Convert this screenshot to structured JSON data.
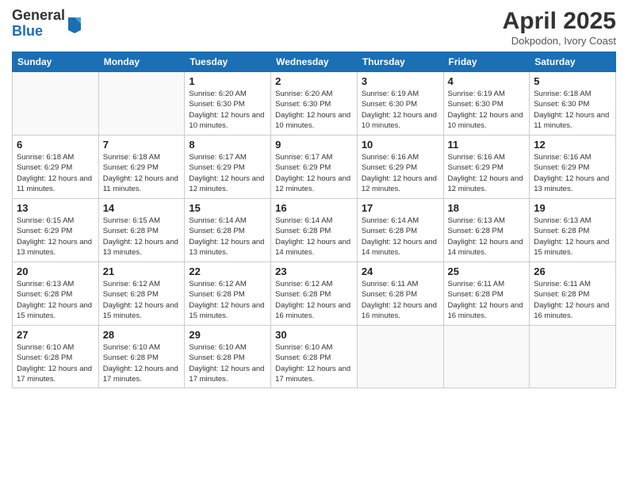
{
  "logo": {
    "general": "General",
    "blue": "Blue"
  },
  "title": "April 2025",
  "subtitle": "Dokpodon, Ivory Coast",
  "headers": [
    "Sunday",
    "Monday",
    "Tuesday",
    "Wednesday",
    "Thursday",
    "Friday",
    "Saturday"
  ],
  "weeks": [
    [
      {
        "day": "",
        "info": ""
      },
      {
        "day": "",
        "info": ""
      },
      {
        "day": "1",
        "info": "Sunrise: 6:20 AM\nSunset: 6:30 PM\nDaylight: 12 hours and 10 minutes."
      },
      {
        "day": "2",
        "info": "Sunrise: 6:20 AM\nSunset: 6:30 PM\nDaylight: 12 hours and 10 minutes."
      },
      {
        "day": "3",
        "info": "Sunrise: 6:19 AM\nSunset: 6:30 PM\nDaylight: 12 hours and 10 minutes."
      },
      {
        "day": "4",
        "info": "Sunrise: 6:19 AM\nSunset: 6:30 PM\nDaylight: 12 hours and 10 minutes."
      },
      {
        "day": "5",
        "info": "Sunrise: 6:18 AM\nSunset: 6:30 PM\nDaylight: 12 hours and 11 minutes."
      }
    ],
    [
      {
        "day": "6",
        "info": "Sunrise: 6:18 AM\nSunset: 6:29 PM\nDaylight: 12 hours and 11 minutes."
      },
      {
        "day": "7",
        "info": "Sunrise: 6:18 AM\nSunset: 6:29 PM\nDaylight: 12 hours and 11 minutes."
      },
      {
        "day": "8",
        "info": "Sunrise: 6:17 AM\nSunset: 6:29 PM\nDaylight: 12 hours and 12 minutes."
      },
      {
        "day": "9",
        "info": "Sunrise: 6:17 AM\nSunset: 6:29 PM\nDaylight: 12 hours and 12 minutes."
      },
      {
        "day": "10",
        "info": "Sunrise: 6:16 AM\nSunset: 6:29 PM\nDaylight: 12 hours and 12 minutes."
      },
      {
        "day": "11",
        "info": "Sunrise: 6:16 AM\nSunset: 6:29 PM\nDaylight: 12 hours and 12 minutes."
      },
      {
        "day": "12",
        "info": "Sunrise: 6:16 AM\nSunset: 6:29 PM\nDaylight: 12 hours and 13 minutes."
      }
    ],
    [
      {
        "day": "13",
        "info": "Sunrise: 6:15 AM\nSunset: 6:29 PM\nDaylight: 12 hours and 13 minutes."
      },
      {
        "day": "14",
        "info": "Sunrise: 6:15 AM\nSunset: 6:28 PM\nDaylight: 12 hours and 13 minutes."
      },
      {
        "day": "15",
        "info": "Sunrise: 6:14 AM\nSunset: 6:28 PM\nDaylight: 12 hours and 13 minutes."
      },
      {
        "day": "16",
        "info": "Sunrise: 6:14 AM\nSunset: 6:28 PM\nDaylight: 12 hours and 14 minutes."
      },
      {
        "day": "17",
        "info": "Sunrise: 6:14 AM\nSunset: 6:28 PM\nDaylight: 12 hours and 14 minutes."
      },
      {
        "day": "18",
        "info": "Sunrise: 6:13 AM\nSunset: 6:28 PM\nDaylight: 12 hours and 14 minutes."
      },
      {
        "day": "19",
        "info": "Sunrise: 6:13 AM\nSunset: 6:28 PM\nDaylight: 12 hours and 15 minutes."
      }
    ],
    [
      {
        "day": "20",
        "info": "Sunrise: 6:13 AM\nSunset: 6:28 PM\nDaylight: 12 hours and 15 minutes."
      },
      {
        "day": "21",
        "info": "Sunrise: 6:12 AM\nSunset: 6:28 PM\nDaylight: 12 hours and 15 minutes."
      },
      {
        "day": "22",
        "info": "Sunrise: 6:12 AM\nSunset: 6:28 PM\nDaylight: 12 hours and 15 minutes."
      },
      {
        "day": "23",
        "info": "Sunrise: 6:12 AM\nSunset: 6:28 PM\nDaylight: 12 hours and 16 minutes."
      },
      {
        "day": "24",
        "info": "Sunrise: 6:11 AM\nSunset: 6:28 PM\nDaylight: 12 hours and 16 minutes."
      },
      {
        "day": "25",
        "info": "Sunrise: 6:11 AM\nSunset: 6:28 PM\nDaylight: 12 hours and 16 minutes."
      },
      {
        "day": "26",
        "info": "Sunrise: 6:11 AM\nSunset: 6:28 PM\nDaylight: 12 hours and 16 minutes."
      }
    ],
    [
      {
        "day": "27",
        "info": "Sunrise: 6:10 AM\nSunset: 6:28 PM\nDaylight: 12 hours and 17 minutes."
      },
      {
        "day": "28",
        "info": "Sunrise: 6:10 AM\nSunset: 6:28 PM\nDaylight: 12 hours and 17 minutes."
      },
      {
        "day": "29",
        "info": "Sunrise: 6:10 AM\nSunset: 6:28 PM\nDaylight: 12 hours and 17 minutes."
      },
      {
        "day": "30",
        "info": "Sunrise: 6:10 AM\nSunset: 6:28 PM\nDaylight: 12 hours and 17 minutes."
      },
      {
        "day": "",
        "info": ""
      },
      {
        "day": "",
        "info": ""
      },
      {
        "day": "",
        "info": ""
      }
    ]
  ]
}
